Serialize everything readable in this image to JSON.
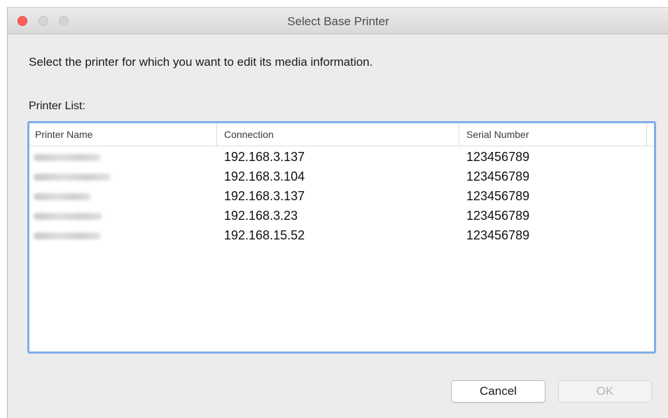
{
  "window": {
    "title": "Select Base Printer"
  },
  "instruction": "Select the printer for which you want to edit its media information.",
  "list_label": "Printer List:",
  "table": {
    "columns": [
      "Printer Name",
      "Connection",
      "Serial Number"
    ],
    "rows": [
      {
        "connection": "192.168.3.137",
        "serial": "123456789"
      },
      {
        "connection": "192.168.3.104",
        "serial": "123456789"
      },
      {
        "connection": "192.168.3.137",
        "serial": "123456789"
      },
      {
        "connection": "192.168.3.23",
        "serial": "123456789"
      },
      {
        "connection": "192.168.15.52",
        "serial": "123456789"
      }
    ]
  },
  "buttons": {
    "cancel": "Cancel",
    "ok": "OK"
  },
  "colors": {
    "close": "#fc5f57",
    "focus_ring": "#7faee8"
  }
}
